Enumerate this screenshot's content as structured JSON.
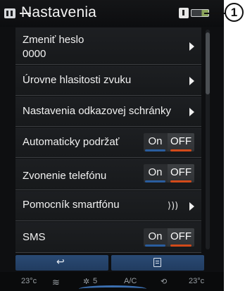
{
  "header": {
    "title": "Nastavenia"
  },
  "callout": {
    "number": "1"
  },
  "settings": {
    "items": [
      {
        "label": "Zmeniť heslo",
        "value": "0000",
        "kind": "submenu"
      },
      {
        "label": "Úrovne hlasitosti zvuku",
        "kind": "submenu"
      },
      {
        "label": "Nastavenia odkazovej schránky",
        "kind": "submenu"
      },
      {
        "label": "Automaticky podržať",
        "kind": "toggle",
        "on": "On",
        "off": "OFF",
        "state": "OFF"
      },
      {
        "label": "Zvonenie telefónu",
        "kind": "toggle",
        "on": "On",
        "off": "OFF",
        "state": "OFF"
      },
      {
        "label": "Pomocník smartfónu",
        "kind": "submenu",
        "icon": "voice-assistant-icon",
        "icon_glyph": "⟩))"
      },
      {
        "label": "SMS",
        "kind": "toggle",
        "on": "On",
        "off": "OFF",
        "state": "OFF"
      }
    ]
  },
  "bottom_bar": {
    "back_icon": "↩",
    "menu_icon": "menu-icon"
  },
  "climate": {
    "left_temp": "23°c",
    "fan_level": "5",
    "ac_label": "A/C",
    "right_temp": "23°c"
  },
  "colors": {
    "accent_blue": "#2a4a74",
    "toggle_off_orange": "#d24a1a",
    "background": "#0e0f11"
  }
}
